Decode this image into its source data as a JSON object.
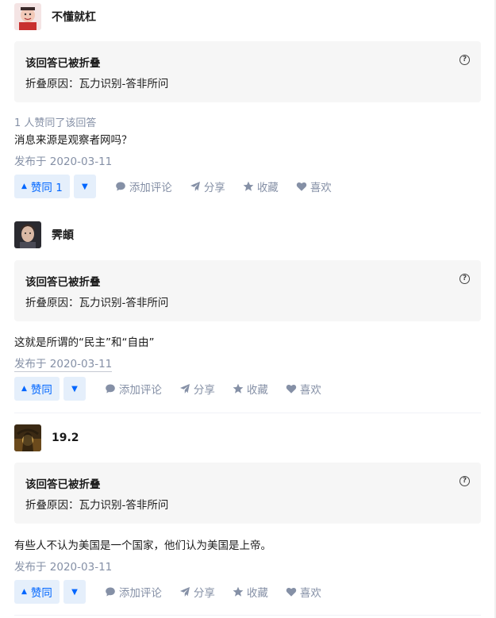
{
  "answers": [
    {
      "author": "不懂就杠",
      "collapsed_title": "该回答已被折叠",
      "collapsed_reason": "折叠原因：瓦力识别-答非所问",
      "voters": "1 人赞同了该回答",
      "content": "消息来源是观察者网吗？",
      "date": "发布于 2020-03-11",
      "vote_label": "赞同 1"
    },
    {
      "author": "霁頔",
      "collapsed_title": "该回答已被折叠",
      "collapsed_reason": "折叠原因：瓦力识别-答非所问",
      "content": "这就是所谓的“民主”和“自由”",
      "date": "发布于 2020-03-11",
      "vote_label": "赞同"
    },
    {
      "author": "19.2",
      "collapsed_title": "该回答已被折叠",
      "collapsed_reason": "折叠原因：瓦力识别-答非所问",
      "content": "有些人不认为美国是一个国家，他们认为美国是上帝。",
      "date": "发布于 2020-03-11",
      "vote_label": "赞同"
    }
  ],
  "actions": {
    "comment": "添加评论",
    "share": "分享",
    "favorite": "收藏",
    "like": "喜欢"
  },
  "colors": {
    "accent": "#0066ff",
    "accent_bg": "#e5effb",
    "muted": "#8590a6",
    "collapsed_bg": "#f6f6f6"
  }
}
